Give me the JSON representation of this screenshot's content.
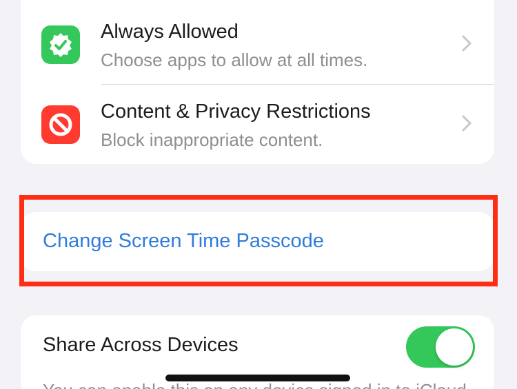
{
  "settings_group": {
    "rows": [
      {
        "title": "Always Allowed",
        "subtitle": "Choose apps to allow at all times.",
        "icon": "checkmark-badge-icon",
        "icon_color": "#34c759"
      },
      {
        "title": "Content & Privacy Restrictions",
        "subtitle": "Block inappropriate content.",
        "icon": "prohibited-icon",
        "icon_color": "#ff3b30"
      }
    ]
  },
  "passcode": {
    "label": "Change Screen Time Passcode",
    "color": "#2f7cdc",
    "highlight_color": "#ff2d13"
  },
  "share": {
    "label": "Share Across Devices",
    "toggle_on": true,
    "toggle_color": "#34c759",
    "footer_partial": "You can enable this on any device signed in to iCloud"
  }
}
